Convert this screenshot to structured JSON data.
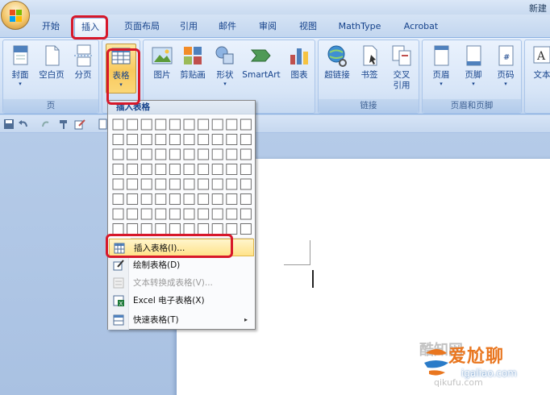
{
  "window": {
    "title": "新建"
  },
  "tabs": [
    {
      "label": "开始"
    },
    {
      "label": "插入",
      "active": true
    },
    {
      "label": "页面布局"
    },
    {
      "label": "引用"
    },
    {
      "label": "邮件"
    },
    {
      "label": "审阅"
    },
    {
      "label": "视图"
    },
    {
      "label": "MathType"
    },
    {
      "label": "Acrobat"
    }
  ],
  "ribbon": {
    "pages": {
      "label": "页",
      "buttons": [
        "封面",
        "空白页",
        "分页"
      ]
    },
    "tables": {
      "button": "表格"
    },
    "illustrations": {
      "buttons": [
        "图片",
        "剪贴画",
        "形状",
        "SmartArt",
        "图表"
      ]
    },
    "links": {
      "label": "链接",
      "buttons": [
        "超链接",
        "书签",
        "交叉",
        "引用"
      ]
    },
    "header_footer": {
      "label": "页眉和页脚",
      "buttons": [
        "页眉",
        "页脚",
        "页码"
      ]
    },
    "text": {
      "buttons": [
        "文本"
      ]
    }
  },
  "dropdown": {
    "header": "插入表格",
    "grid": {
      "columns": 10,
      "rows": 8
    },
    "items": [
      {
        "label": "插入表格(I)...",
        "state": "highlighted"
      },
      {
        "label": "绘制表格(D)",
        "state": "normal"
      },
      {
        "label": "文本转换成表格(V)...",
        "state": "disabled"
      },
      {
        "label": "Excel 电子表格(X)",
        "state": "normal"
      },
      {
        "label": "快速表格(T)",
        "state": "submenu",
        "arrow": "▸"
      }
    ]
  },
  "watermark": {
    "brand": "爱尬聊",
    "domain": "igaliao.com",
    "faded_brand": "酷知网",
    "faded_domain": "qikufu.com"
  },
  "colors": {
    "ribbon_text": "#15428b",
    "highlight": "#d7182a",
    "hover": "#ffe38a",
    "watermark_orange": "#e9761f"
  }
}
